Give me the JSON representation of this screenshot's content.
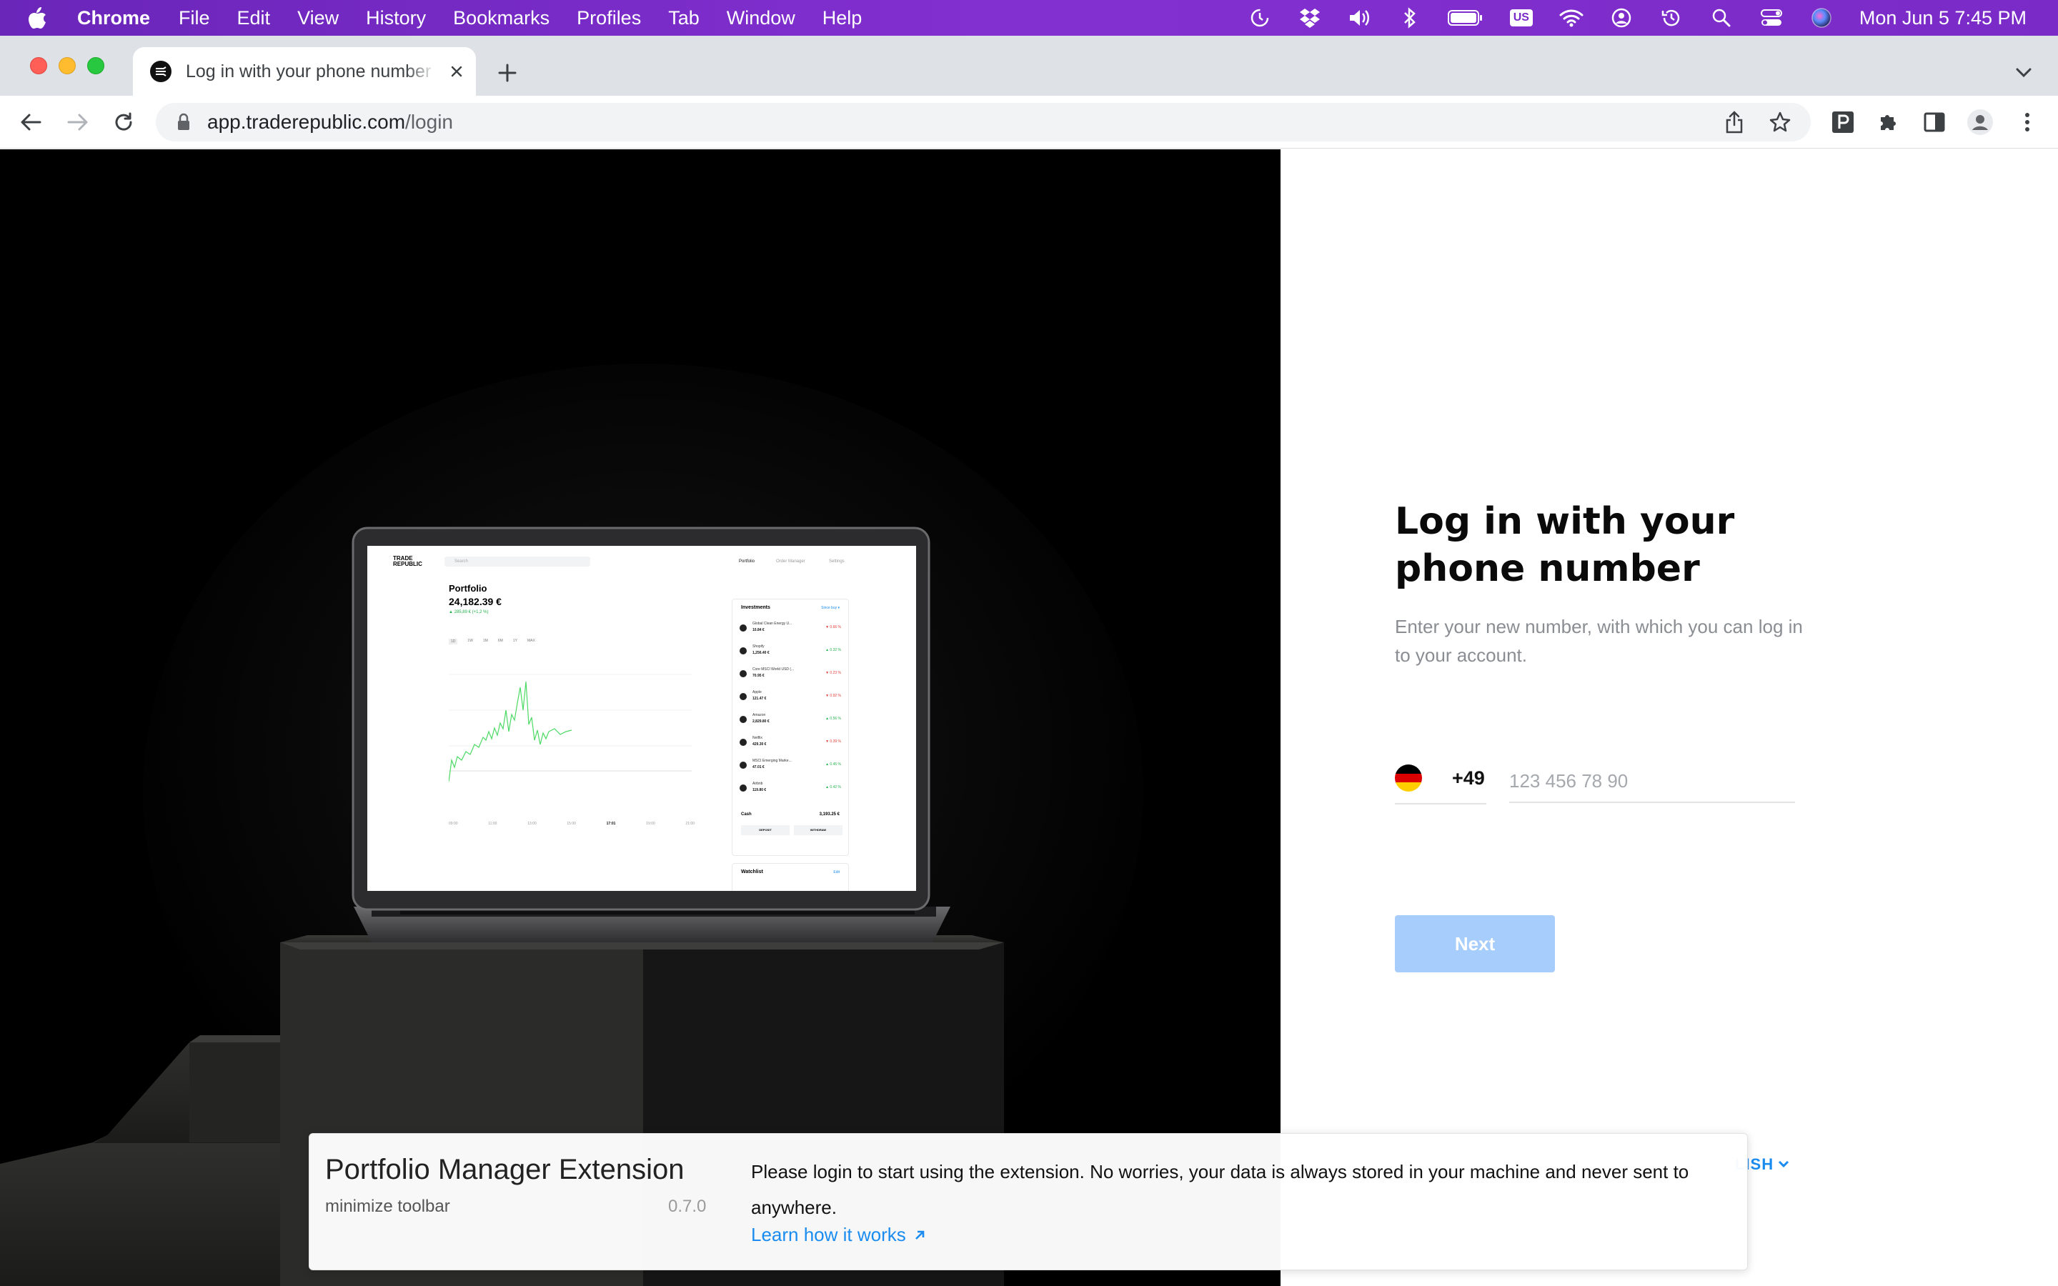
{
  "menubar": {
    "app_name": "Chrome",
    "items": [
      "File",
      "Edit",
      "View",
      "History",
      "Bookmarks",
      "Profiles",
      "Tab",
      "Window",
      "Help"
    ],
    "input_source": "US",
    "clock": "Mon Jun 5  7:45 PM"
  },
  "browser": {
    "tab_title": "Log in with your phone number",
    "url_host": "app.traderepublic.com",
    "url_path": "/login"
  },
  "login": {
    "title": "Log in with your phone number",
    "subtitle": "Enter your new number, with which you can log in to your account.",
    "country_code": "+49",
    "phone_placeholder": "123 456 78 90",
    "phone_value": "",
    "next_label": "Next",
    "next_button_color": "#a6cdfb",
    "language_label": "LISH"
  },
  "laptop_screen": {
    "logo": "TRADE REPUBLIC",
    "search_placeholder": "Search",
    "nav": [
      "Portfolio",
      "Order Manager",
      "Settings"
    ],
    "portfolio_label": "Portfolio",
    "portfolio_value": "24,182.39 €",
    "portfolio_change": "▲ 285,89 € (+1,2 %)",
    "ranges": [
      "1D",
      "1W",
      "1M",
      "6M",
      "1Y",
      "MAX"
    ],
    "time_labels": [
      "09:00",
      "11:00",
      "13:00",
      "15:00",
      "17:01",
      "19:00",
      "21:00"
    ],
    "investments_title": "Investments",
    "investments_link": "Since buy ▾",
    "investments": [
      {
        "name": "Global Clean Energy U...",
        "value": "10.84 €",
        "change": "▼ 0.66 %",
        "dir": "down"
      },
      {
        "name": "Shopify",
        "value": "1,256.40 €",
        "change": "▲ 0.32 %",
        "dir": "up"
      },
      {
        "name": "Core MSCI World USD (...",
        "value": "70.95 €",
        "change": "▼ 0.23 %",
        "dir": "down"
      },
      {
        "name": "Apple",
        "value": "121.47 €",
        "change": "▼ 0.92 %",
        "dir": "down"
      },
      {
        "name": "Amazon",
        "value": "2,829.80 €",
        "change": "▲ 0.56 %",
        "dir": "up"
      },
      {
        "name": "Netflix",
        "value": "429.30 €",
        "change": "▼ 0.39 %",
        "dir": "down"
      },
      {
        "name": "MSCI Emerging Marke...",
        "value": "47.01 €",
        "change": "▲ 0.45 %",
        "dir": "up"
      },
      {
        "name": "Airbnb",
        "value": "119.80 €",
        "change": "▲ 0.42 %",
        "dir": "up"
      }
    ],
    "cash_label": "Cash",
    "cash_value": "3,193.25 €",
    "deposit_label": "DEPOSIT",
    "withdraw_label": "WITHDRAW",
    "watchlist_label": "Watchlist",
    "watchlist_link": "Edit"
  },
  "extension": {
    "title": "Portfolio Manager Extension",
    "minimize_label": "minimize toolbar",
    "version": "0.7.0",
    "message": "Please login to start using the extension. No worries, your data is always stored in your machine and never sent to anywhere.",
    "link_label": "Learn how it works"
  },
  "icons": {
    "status": [
      "screen-time-icon",
      "dropbox-icon",
      "volume-icon",
      "bluetooth-icon",
      "battery-icon",
      "input-source-icon",
      "wifi-icon",
      "user-icon",
      "time-machine-icon",
      "spotlight-icon",
      "control-center-icon",
      "siri-icon"
    ],
    "toolbar": [
      "back-icon",
      "forward-icon",
      "reload-icon",
      "lock-icon",
      "share-icon",
      "bookmark-star-icon",
      "extension-p-icon",
      "puzzle-icon",
      "side-panel-icon",
      "profile-icon",
      "more-icon"
    ]
  },
  "colors": {
    "menubar": "#7a2bc7",
    "hero_background": "#000000",
    "link": "#1a8cf0",
    "chart_line": "#4cd964",
    "positive": "#22b14c",
    "negative": "#e53935"
  }
}
